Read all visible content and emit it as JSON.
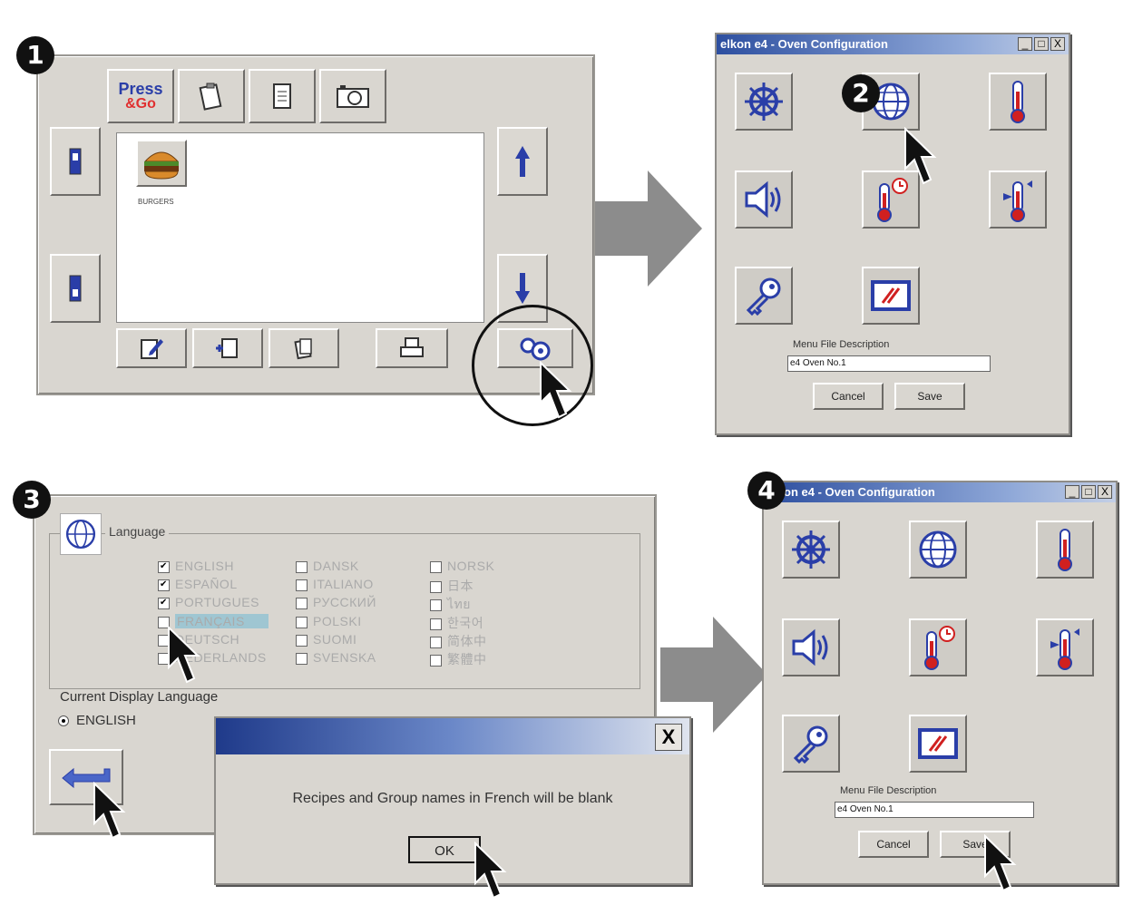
{
  "steps": [
    "1",
    "2",
    "3",
    "4"
  ],
  "press_go": {
    "logo_top": "Press",
    "logo_bottom": "&Go",
    "group_label": "BURGERS"
  },
  "oven_config": {
    "title": "elkon e4 - Oven Configuration",
    "window_controls": [
      "_",
      "□",
      "X"
    ],
    "menu_file_label": "Menu File Description",
    "menu_file_value": "e4 Oven No.1",
    "cancel": "Cancel",
    "save": "Save"
  },
  "oven_config_4": {
    "title": "on e4 - Oven Configuration",
    "menu_file_label": "Menu File Description",
    "menu_file_value": "e4 Oven No.1",
    "cancel": "Cancel",
    "save": "Save"
  },
  "language": {
    "group_label": "Language",
    "col1": [
      {
        "label": "ENGLISH",
        "checked": true
      },
      {
        "label": "ESPAÑOL",
        "checked": true
      },
      {
        "label": "PORTUGUES",
        "checked": true
      },
      {
        "label": "FRANÇAIS",
        "checked": false
      },
      {
        "label": "DEUTSCH",
        "checked": false
      },
      {
        "label": "NEDERLANDS",
        "checked": false
      }
    ],
    "col2": [
      "DANSK",
      "ITALIANO",
      "РУССКИЙ",
      "POLSKI",
      "SUOMI",
      "SVENSKA"
    ],
    "col3": [
      "NORSK",
      "日本",
      "ไทย",
      "한국어",
      "简体中",
      "繁體中"
    ],
    "current_label": "Current Display Language",
    "current_value": "ENGLISH"
  },
  "dialog": {
    "close": "X",
    "message": "Recipes and Group names in French will be blank",
    "ok": "OK"
  }
}
